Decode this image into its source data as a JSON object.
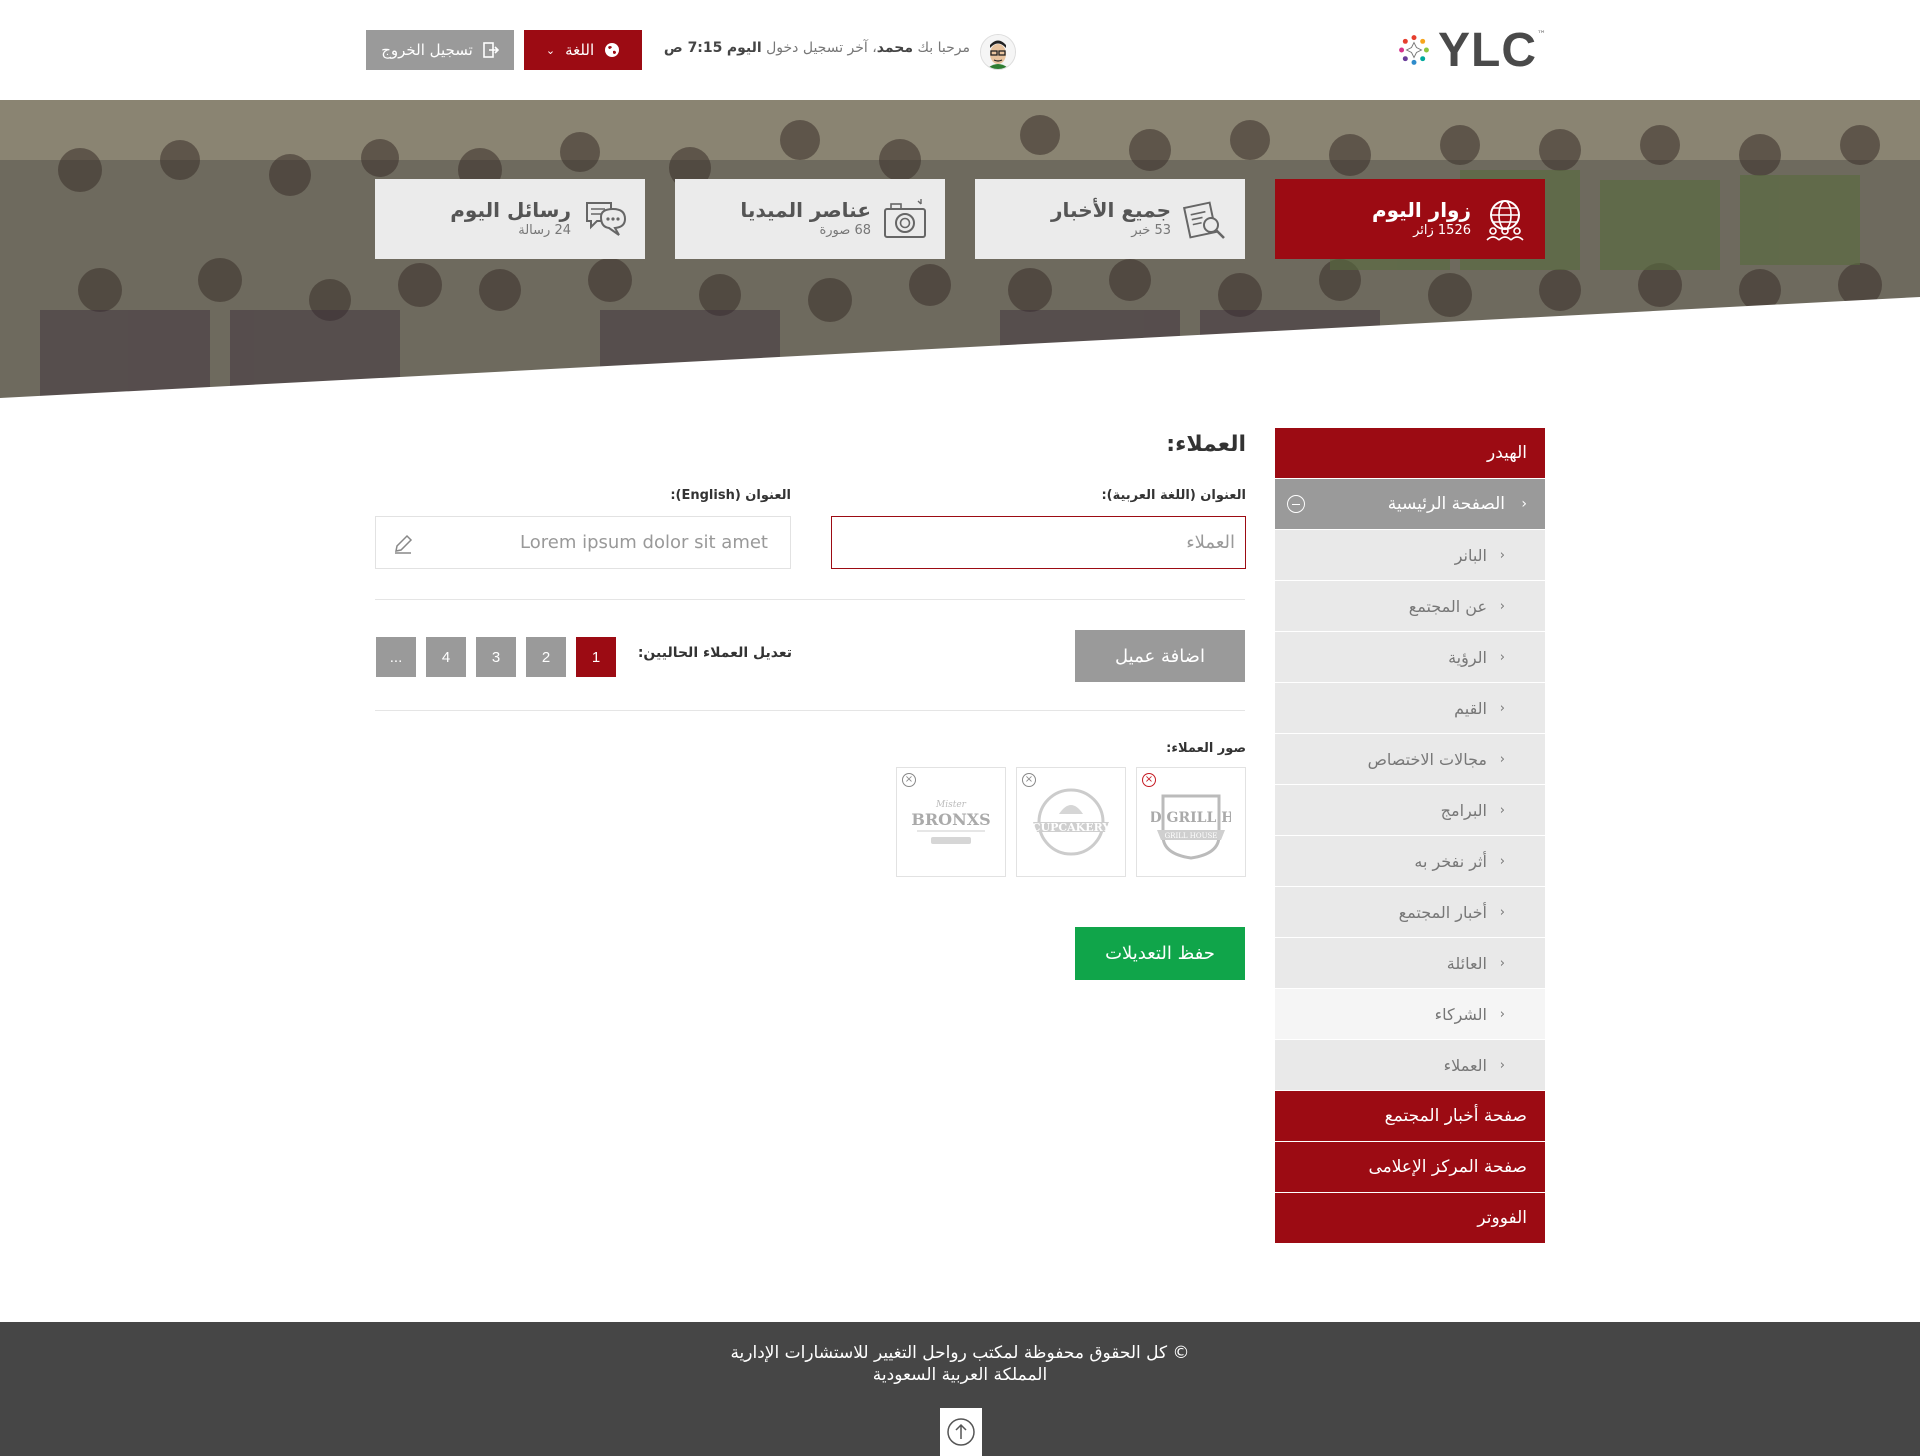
{
  "header": {
    "logo_text": "YLC",
    "logo_tm": "™",
    "welcome_prefix": "مرحبا بك",
    "user_name": "محمد",
    "last_login_label": "، آخر تسجيل دخول",
    "today": "اليوم",
    "login_time": "7:15 ص",
    "language_label": "اللغة",
    "logout_label": "تسجيل الخروج"
  },
  "stats": [
    {
      "title": "زوار اليوم",
      "sub": "1526 زائر",
      "icon": "globe-people-icon",
      "active": true
    },
    {
      "title": "جميع الأخبار",
      "sub": "53 خبر",
      "icon": "news-search-icon",
      "active": false
    },
    {
      "title": "عناصر الميديا",
      "sub": "68 صورة",
      "icon": "camera-icon",
      "active": false
    },
    {
      "title": "رسائل اليوم",
      "sub": "24 رسالة",
      "icon": "chat-bubbles-icon",
      "active": false
    }
  ],
  "sidebar": {
    "header": "الهيدر",
    "home": "الصفحة الرئيسية",
    "sub_items": [
      "البانر",
      "عن المجتمع",
      "الرؤية",
      "القيم",
      "مجالات الاختصاص",
      "البرامج",
      "أثر نفخر به",
      "أخبار المجتمع",
      "العائلة",
      "الشركاء",
      "العملاء"
    ],
    "news_page": "صفحة أخبار المجتمع",
    "media_page": "صفحة المركز الإعلامى",
    "footer": "الفووتر"
  },
  "main": {
    "title": "العملاء:",
    "label_ar": "العنوان (اللغة العربية):",
    "label_en": "العنوان (English):",
    "value_ar": "العملاء",
    "value_en": "Lorem ipsum dolor sit amet",
    "add_client": "اضافة عميل",
    "edit_current": "تعديل العملاء الحاليين:",
    "pages": [
      "1",
      "2",
      "3",
      "4",
      "..."
    ],
    "active_page": "1",
    "images_label": "صور العملاء:",
    "thumbs": [
      "BRAND GRILL HOUSE",
      "CUPCAKERY",
      "BRONXS"
    ],
    "save": "حفظ التعديلات"
  },
  "footer": {
    "line1": "© كل الحقوق محفوظة لمكتب رواحل التغيير للاستشارات الإدارية",
    "line2": "المملكة العربية السعودية"
  },
  "colors": {
    "brand_red": "#9c0b13",
    "gray_button": "#9a9a9a",
    "save_green": "#10a54a",
    "footer_bg": "#464646"
  }
}
